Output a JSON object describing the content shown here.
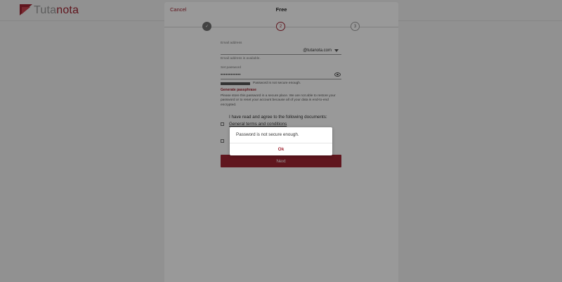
{
  "app": {
    "logo_prefix": "Tuta",
    "logo_suffix": "nota"
  },
  "dialog": {
    "cancel_label": "Cancel",
    "title": "Free",
    "steps": [
      "✓",
      "2",
      "3"
    ]
  },
  "form": {
    "email_label": "Email address",
    "email_domain": "@tutanota.com",
    "email_helper": "Email address is available.",
    "password_label": "Set password",
    "password_value": "••••••••••••",
    "strength": 1.0,
    "strength_text": "Password is not secure enough.",
    "generate_label": "Generate passphrase",
    "notice": "Please store this password in a secure place. We are not able to restore your password or to reset your account because all of your data is end-to-end encrypted.",
    "agree_text": "I have read and agree to the following documents:",
    "terms_label": "General terms and conditions",
    "next_label": "Next"
  },
  "alert": {
    "message": "Password is not secure enough.",
    "ok_label": "Ok"
  },
  "colors": {
    "accent": "#a02532",
    "overlay": "rgba(0,0,0,0.4)"
  }
}
